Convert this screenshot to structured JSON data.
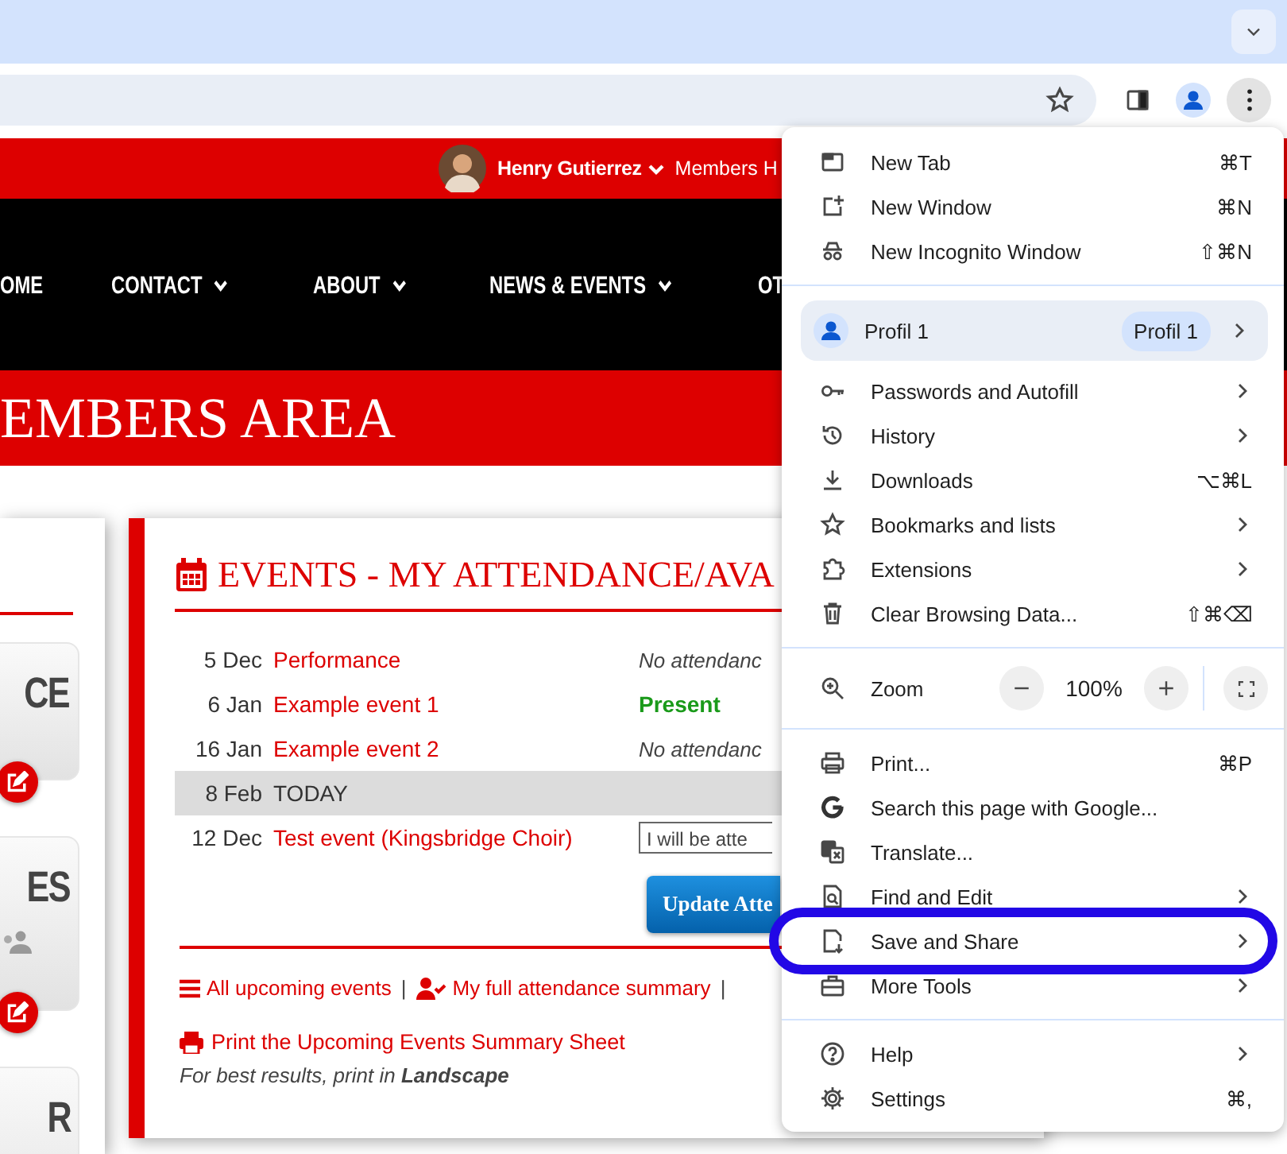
{
  "browser": {
    "menu_button_active": true
  },
  "site": {
    "user_name": "Henry Gutierrez",
    "top_link": "Members H",
    "nav": [
      {
        "label": "OME",
        "dropdown": false
      },
      {
        "label": "CONTACT",
        "dropdown": true
      },
      {
        "label": "ABOUT",
        "dropdown": true
      },
      {
        "label": "NEWS & EVENTS",
        "dropdown": true
      },
      {
        "label": "OT"
      }
    ],
    "banner": "EMBERS AREA"
  },
  "sidebar": {
    "tiles": [
      {
        "label": "CE",
        "editable": true
      },
      {
        "label": "ES",
        "editable": true
      },
      {
        "label": "R",
        "editable": false
      }
    ]
  },
  "events": {
    "title": "EVENTS - MY ATTENDANCE/AVA",
    "rows": [
      {
        "date": "5 Dec",
        "name": "Performance",
        "today": false,
        "status": {
          "kind": "note",
          "text": "No attendanc"
        }
      },
      {
        "date": "6 Jan",
        "name": "Example event 1",
        "today": false,
        "status": {
          "kind": "present",
          "text": "Present"
        }
      },
      {
        "date": "16 Jan",
        "name": "Example event 2",
        "today": false,
        "status": {
          "kind": "note",
          "text": "No attendanc"
        }
      },
      {
        "date": "8 Feb",
        "name": "TODAY",
        "today": true
      },
      {
        "date": "12 Dec",
        "name": "Test event (Kingsbridge Choir)",
        "today": false,
        "status": {
          "kind": "select",
          "value": "I will be atte"
        }
      }
    ],
    "update_button": "Update Atte",
    "links": [
      {
        "label": "All upcoming events",
        "separator": "|"
      },
      {
        "label": "My full attendance summary",
        "separator": "|"
      }
    ],
    "print_link": "Print the Upcoming Events Summary Sheet",
    "print_note": "For best results, print in **Landscape**"
  },
  "menu": {
    "items": [
      {
        "kind": "item",
        "label": "New Tab",
        "shortcut": "⌘T",
        "submenu": false,
        "annotated": false
      },
      {
        "kind": "item",
        "label": "New Window",
        "shortcut": "⌘N",
        "submenu": false,
        "annotated": false
      },
      {
        "kind": "item",
        "label": "New Incognito Window",
        "shortcut": "⇧⌘N",
        "submenu": false,
        "annotated": false
      },
      {
        "kind": "divider"
      },
      {
        "kind": "profile",
        "label": "Profil 1",
        "badge": "Profil 1",
        "submenu": true
      },
      {
        "kind": "item",
        "label": "Passwords and Autofill",
        "submenu": true,
        "annotated": false
      },
      {
        "kind": "item",
        "label": "History",
        "submenu": true,
        "annotated": false
      },
      {
        "kind": "item",
        "label": "Downloads",
        "shortcut": "⌥⌘L",
        "submenu": false,
        "annotated": false
      },
      {
        "kind": "item",
        "label": "Bookmarks and lists",
        "submenu": true,
        "annotated": false
      },
      {
        "kind": "item",
        "label": "Extensions",
        "submenu": true,
        "annotated": false
      },
      {
        "kind": "item",
        "label": "Clear Browsing Data...",
        "shortcut": "⇧⌘⌫",
        "submenu": false,
        "annotated": false
      },
      {
        "kind": "divider"
      },
      {
        "kind": "zoom",
        "label": "Zoom",
        "value": "100%"
      },
      {
        "kind": "divider"
      },
      {
        "kind": "item",
        "label": "Print...",
        "shortcut": "⌘P",
        "submenu": false,
        "annotated": false
      },
      {
        "kind": "item",
        "label": "Search this page with Google...",
        "submenu": false,
        "annotated": false
      },
      {
        "kind": "item",
        "label": "Translate...",
        "submenu": false,
        "annotated": false
      },
      {
        "kind": "item",
        "label": "Find and Edit",
        "submenu": true,
        "annotated": false
      },
      {
        "kind": "item",
        "label": "Save and Share",
        "submenu": true,
        "annotated": true
      },
      {
        "kind": "item",
        "label": "More Tools",
        "submenu": true,
        "annotated": false
      },
      {
        "kind": "divider"
      },
      {
        "kind": "item",
        "label": "Help",
        "submenu": true,
        "annotated": false
      },
      {
        "kind": "item",
        "label": "Settings",
        "shortcut": "⌘,",
        "submenu": false,
        "annotated": false
      }
    ]
  }
}
